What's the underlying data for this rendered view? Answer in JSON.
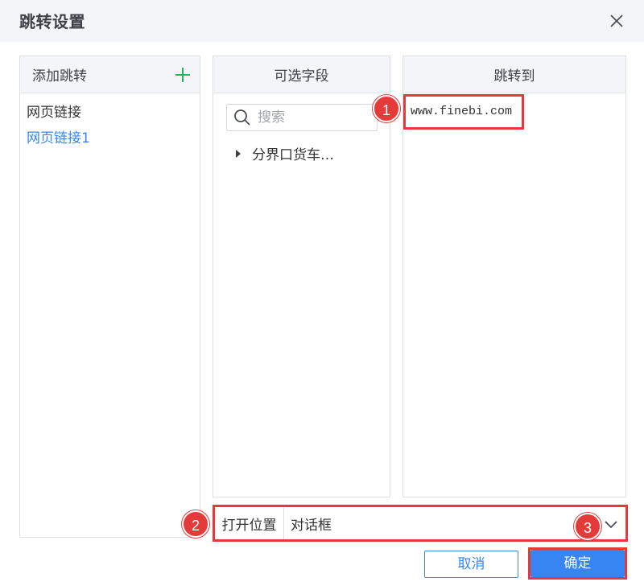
{
  "dialog": {
    "title": "跳转设置"
  },
  "panels": {
    "add_jump": {
      "title": "添加跳转",
      "items": [
        "网页链接",
        "网页链接1"
      ]
    },
    "fields": {
      "title": "可选字段",
      "search_placeholder": "搜索",
      "tree_node": "分界口货车…"
    },
    "jump_to": {
      "title": "跳转到",
      "url": "www.finebi.com"
    }
  },
  "open_position": {
    "label": "打开位置",
    "value": "对话框"
  },
  "buttons": {
    "cancel": "取消",
    "confirm": "确定"
  },
  "badges": [
    "1",
    "2",
    "3"
  ],
  "colors": {
    "accent": "#3685f2",
    "highlight": "#e53a3a",
    "add_icon": "#1fb85d"
  },
  "icons": {
    "close": "close-icon",
    "add": "plus-icon",
    "search": "search-icon",
    "caret": "caret-right-icon",
    "dropdown": "chevron-down-icon"
  }
}
